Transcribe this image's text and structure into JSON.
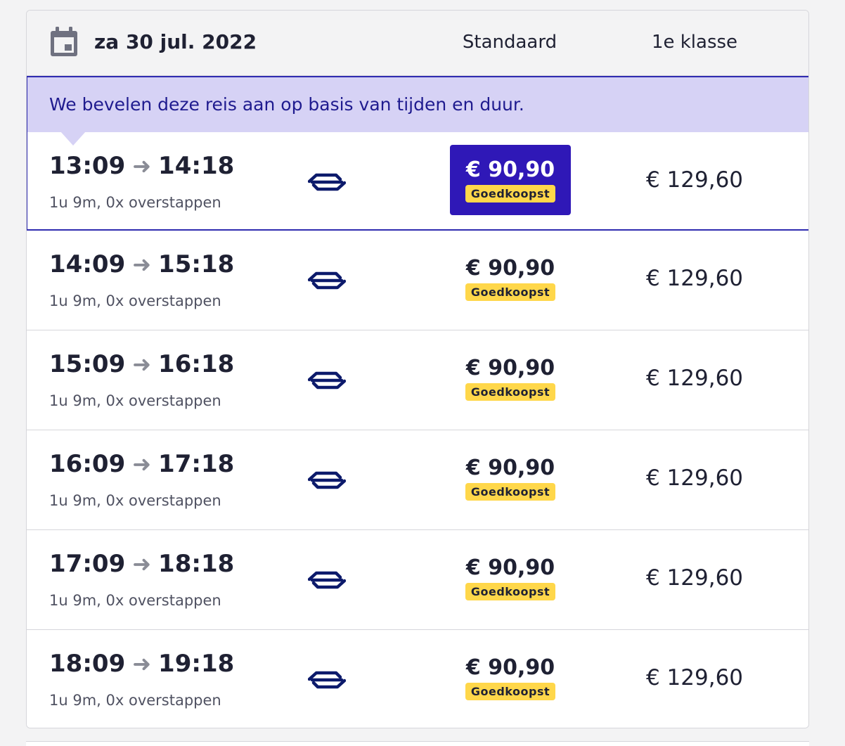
{
  "header": {
    "date": "za 30 jul. 2022",
    "col_standard": "Standaard",
    "col_first": "1e klasse"
  },
  "recommendation": {
    "text": "We bevelen deze reis aan op basis van tijden en duur."
  },
  "rows": [
    {
      "depart": "13:09",
      "arrive": "14:18",
      "info": "1u 9m, 0x overstappen",
      "std_price": "€ 90,90",
      "badge": "Goedkoopst",
      "first_price": "€ 129,60",
      "selected": true
    },
    {
      "depart": "14:09",
      "arrive": "15:18",
      "info": "1u 9m, 0x overstappen",
      "std_price": "€ 90,90",
      "badge": "Goedkoopst",
      "first_price": "€ 129,60",
      "selected": false
    },
    {
      "depart": "15:09",
      "arrive": "16:18",
      "info": "1u 9m, 0x overstappen",
      "std_price": "€ 90,90",
      "badge": "Goedkoopst",
      "first_price": "€ 129,60",
      "selected": false
    },
    {
      "depart": "16:09",
      "arrive": "17:18",
      "info": "1u 9m, 0x overstappen",
      "std_price": "€ 90,90",
      "badge": "Goedkoopst",
      "first_price": "€ 129,60",
      "selected": false
    },
    {
      "depart": "17:09",
      "arrive": "18:18",
      "info": "1u 9m, 0x overstappen",
      "std_price": "€ 90,90",
      "badge": "Goedkoopst",
      "first_price": "€ 129,60",
      "selected": false
    },
    {
      "depart": "18:09",
      "arrive": "19:18",
      "info": "1u 9m, 0x overstappen",
      "std_price": "€ 90,90",
      "badge": "Goedkoopst",
      "first_price": "€ 129,60",
      "selected": false
    }
  ],
  "icons": {
    "calendar": "calendar-icon",
    "arrow": "arrow-right-icon",
    "operator": "ns-logo-icon"
  },
  "colors": {
    "selected_bg": "#2f18b7",
    "badge_bg": "#ffd74a",
    "recommend_bg": "#d6d2f5",
    "ns_blue": "#0c1a6b"
  }
}
